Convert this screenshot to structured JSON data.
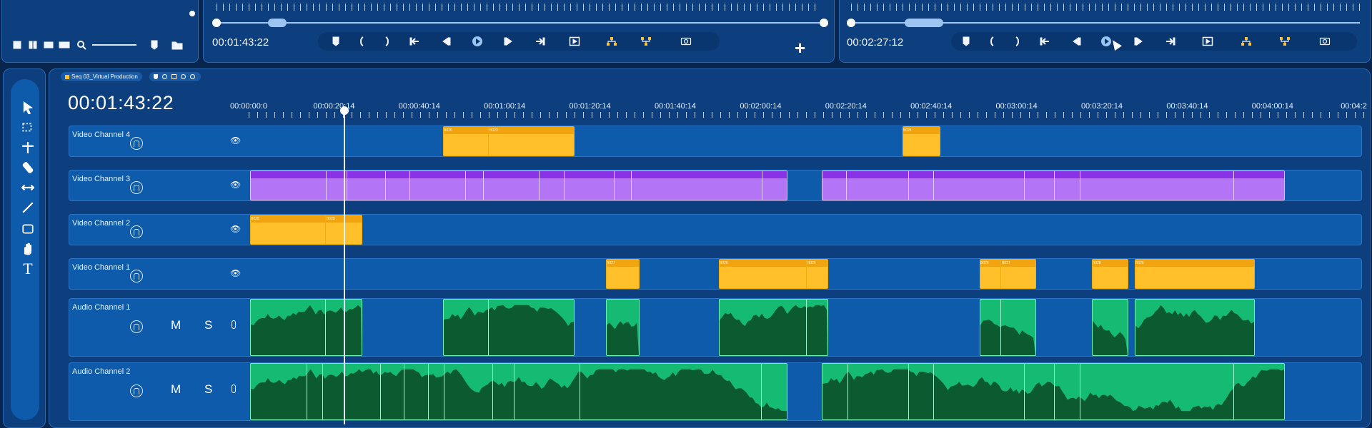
{
  "left_panel": {
    "icons": [
      "list-view-icon",
      "thumbnail-view-icon",
      "filmstrip-view-icon",
      "zoom-icon",
      "zoom-slider",
      "marker-icon",
      "folder-icon"
    ]
  },
  "source_monitor": {
    "timecode": "00:01:43:22"
  },
  "program_monitor": {
    "timecode": "00:02:27:12",
    "add_label": "+"
  },
  "transport_icons": [
    "marker",
    "mark-in",
    "mark-out",
    "go-to-in",
    "step-back",
    "play",
    "step-forward",
    "go-to-out",
    "play-in-to-out",
    "insert",
    "overwrite",
    "export-frame"
  ],
  "sequence": {
    "tab_label": "Seq 03_Virtual Production",
    "timecode": "00:01:43:22"
  },
  "ruler": [
    "00:00:00:0",
    "00:00:20:14",
    "00:00:40:14",
    "00:01:00:14",
    "00:01:20:14",
    "00:01:40:14",
    "00:02:00:14",
    "00:02:20:14",
    "00:02:40:14",
    "00:03:00:14",
    "00:03:20:14",
    "00:03:40:14",
    "00:04:00:14",
    "00:04:2"
  ],
  "tools": [
    "selection-tool",
    "marquee-tool",
    "ripple-tool",
    "razor-tool",
    "slip-tool",
    "pen-tool",
    "rectangle-tool",
    "hand-tool",
    "type-tool"
  ],
  "tracks": [
    {
      "name": "Video Channel 4",
      "type": "video"
    },
    {
      "name": "Video Channel 3",
      "type": "video"
    },
    {
      "name": "Video Channel 2",
      "type": "video"
    },
    {
      "name": "Video Channel 1",
      "type": "video"
    },
    {
      "name": "Audio Channel 1",
      "type": "audio",
      "mute": "M",
      "solo": "S"
    },
    {
      "name": "Audio Channel 2",
      "type": "audio",
      "mute": "M",
      "solo": "S"
    }
  ],
  "colors": {
    "video_clip": "#ffc02a",
    "broll_clip": "#b374f6",
    "audio_clip": "#15ba73",
    "track_bg": "#0e5aab",
    "panel_bg": "#0d3f7e"
  }
}
